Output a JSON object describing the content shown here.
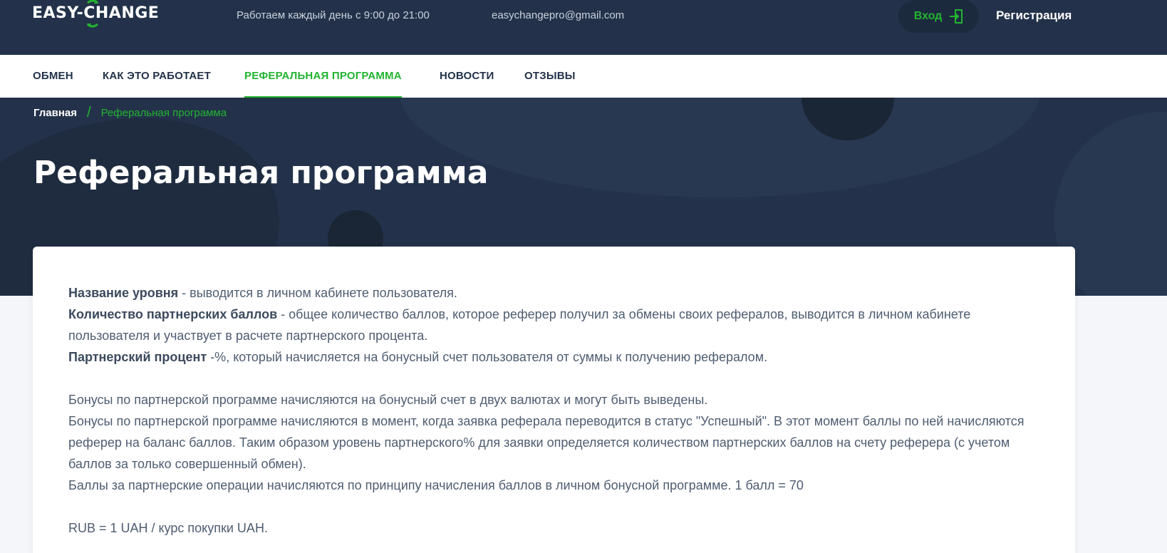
{
  "header": {
    "logo_left": "EASY",
    "logo_right": "CHANGE",
    "hours": "Работаем каждый день с 9:00 до 21:00",
    "email": "easychangepro@gmail.com",
    "login_label": "Вход",
    "register_label": "Регистрация",
    "accent_color": "#22b430",
    "bg_color": "#23324a"
  },
  "nav": {
    "items": [
      {
        "label": "ОБМЕН"
      },
      {
        "label": "КАК ЭТО РАБОТАЕТ"
      },
      {
        "label": "РЕФЕРАЛЬНАЯ ПРОГРАММА",
        "active": true
      },
      {
        "label": "НОВОСТИ"
      },
      {
        "label": "ОТЗЫВЫ"
      }
    ]
  },
  "breadcrumb": {
    "home": "Главная",
    "separator": "/",
    "current": "Реферальная программа"
  },
  "page": {
    "title": "Реферальная программа"
  },
  "content": {
    "level_name_term": "Название уровня",
    "level_name_desc": " - выводится в личном кабинете пользователя.",
    "points_term": "Количество партнерских баллов",
    "points_desc": " - общее количество баллов, которое реферер получил за обмены своих рефералов, выводится в личном кабинете пользователя и участвует в расчете партнерского процента.",
    "percent_term": "Партнерский процент",
    "percent_desc": " -%, который начисляется на бонусный счет пользователя от суммы к получению рефералом.",
    "para1": "Бонусы по партнерской программе начисляются на бонусный счет в двух валютах и могут быть выведены.",
    "para2": "Бонусы по партнерской программе начисляются в момент, когда заявка реферала переводится в статус \"Успешный\". В этот момент баллы по ней начисляются реферер на баланс баллов. Таким образом уровень партнерского% для заявки определяется количеством партнерских баллов на счету реферера (с учетом баллов за только совершенный обмен).",
    "para3": "Баллы за партнерские операции начисляются по принципу начисления баллов в личном бонусной программе. 1 балл = 70",
    "para4": "RUB = 1 UAH / курс покупки UAH."
  }
}
